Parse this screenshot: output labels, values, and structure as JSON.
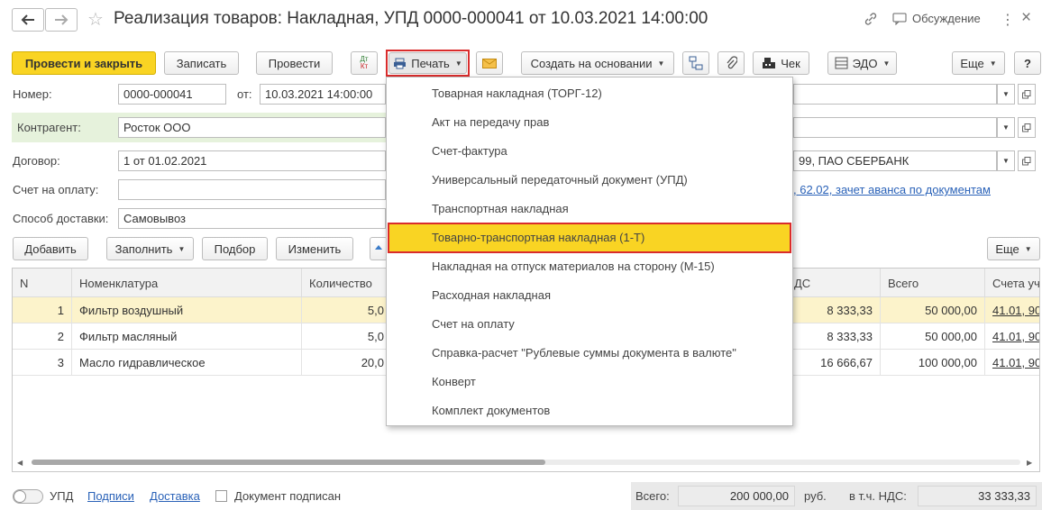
{
  "window": {
    "title": "Реализация товаров: Накладная, УПД 0000-000041 от 10.03.2021 14:00:00",
    "discussion_label": "Обсуждение"
  },
  "toolbar": {
    "post_close": "Провести и закрыть",
    "save": "Записать",
    "post": "Провести",
    "dtkt_top": "Дт",
    "dtkt_bottom": "Кт",
    "print": "Печать",
    "create_based": "Создать на основании",
    "check": "Чек",
    "edo": "ЭДО",
    "more": "Еще",
    "help": "?"
  },
  "form": {
    "number_label": "Номер:",
    "number_value": "0000-000041",
    "date_label": "от:",
    "date_value": "10.03.2021 14:00:00",
    "counterparty_label": "Контрагент:",
    "counterparty_value": "Росток ООО",
    "contract_label": "Договор:",
    "contract_value": "1 от 01.02.2021",
    "invoice_label": "Счет на оплату:",
    "invoice_value": "",
    "delivery_label": "Способ доставки:",
    "delivery_value": "Самовывоз",
    "bank_value_tail": "99, ПАО СБЕРБАНК",
    "accounts_link": ", 62.02, зачет аванса по документам"
  },
  "table_toolbar": {
    "add": "Добавить",
    "fill": "Заполнить",
    "selection": "Подбор",
    "edit": "Изменить",
    "more": "Еще"
  },
  "table": {
    "columns": [
      "N",
      "Номенклатура",
      "Количество",
      "ДС",
      "Всего",
      "Счета уч"
    ],
    "rows": [
      {
        "n": "1",
        "name": "Фильтр воздушный",
        "qty": "5,0",
        "vat": "8 333,33",
        "total": "50 000,00",
        "accounts": "41.01, 90"
      },
      {
        "n": "2",
        "name": "Фильтр масляный",
        "qty": "5,0",
        "vat": "8 333,33",
        "total": "50 000,00",
        "accounts": "41.01, 90"
      },
      {
        "n": "3",
        "name": "Масло гидравлическое",
        "qty": "20,0",
        "vat": "16 666,67",
        "total": "100 000,00",
        "accounts": "41.01, 90"
      }
    ],
    "selected_row": 1
  },
  "print_menu": {
    "items": [
      "Товарная накладная (ТОРГ-12)",
      "Акт на передачу прав",
      "Счет-фактура",
      "Универсальный передаточный документ (УПД)",
      "Транспортная накладная",
      "Товарно-транспортная накладная (1-Т)",
      "Накладная на отпуск материалов на сторону (М-15)",
      "Расходная накладная",
      "Счет на оплату",
      "Справка-расчет \"Рублевые суммы документа в валюте\"",
      "Конверт",
      "Комплект документов"
    ],
    "highlighted_index": 5
  },
  "footer": {
    "upd_label": "УПД",
    "signatures_link": "Подписи",
    "delivery_link": "Доставка",
    "signed_label": "Документ подписан",
    "total_label": "Всего:",
    "total_value": "200 000,00",
    "currency": "руб.",
    "vat_label": "в т.ч. НДС:",
    "vat_value": "33 333,33"
  },
  "colors": {
    "accent_yellow": "#f9d423",
    "highlight_red": "#d92c2c",
    "selected_row": "#fcf3cb",
    "link_blue": "#2a62b8",
    "counterparty_bg": "#e6f2dc"
  },
  "icons": [
    "back-arrow-icon",
    "forward-arrow-icon",
    "star-icon",
    "link-icon",
    "discussion-icon",
    "more-vertical-icon",
    "close-icon",
    "dtkt-icon",
    "printer-icon",
    "envelope-icon",
    "structure-icon",
    "paperclip-icon",
    "cash-register-icon",
    "edo-icon",
    "open-icon"
  ]
}
